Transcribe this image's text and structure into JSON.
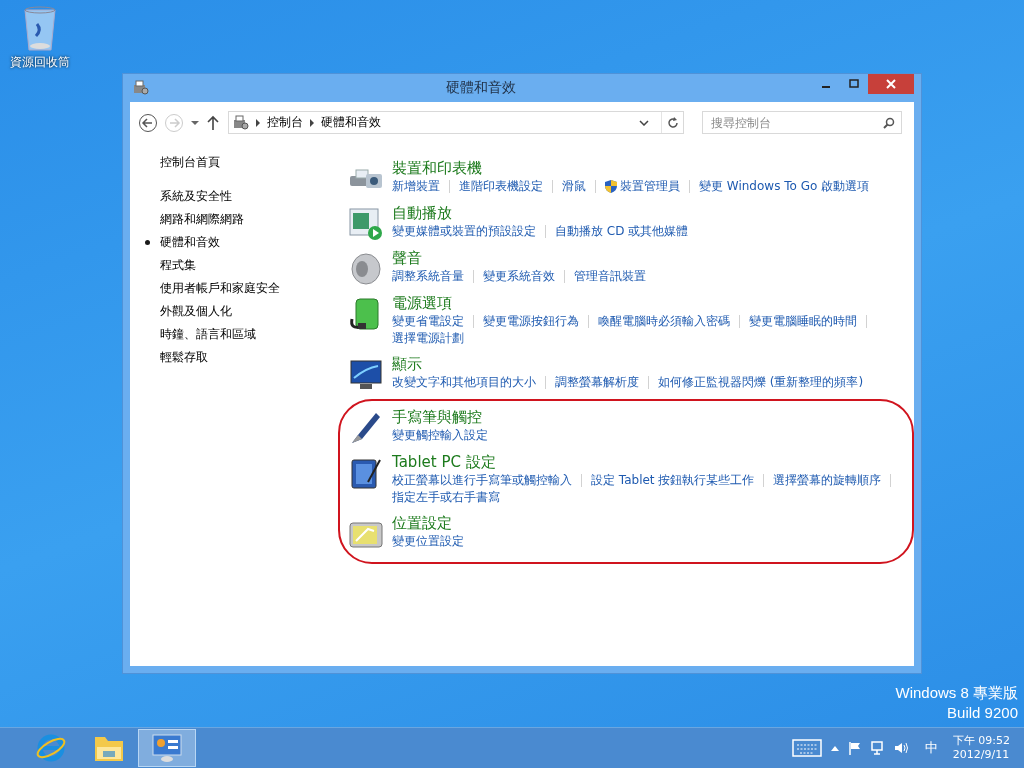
{
  "desktop_icons": [
    {
      "label": "資源回收筒"
    }
  ],
  "window": {
    "title": "硬體和音效"
  },
  "address_bar": {
    "breadcrumb": [
      "控制台",
      "硬體和音效"
    ]
  },
  "search": {
    "placeholder": "搜尋控制台"
  },
  "sidebar": {
    "home": "控制台首頁",
    "items": [
      {
        "label": "系統及安全性",
        "selected": false
      },
      {
        "label": "網路和網際網路",
        "selected": false
      },
      {
        "label": "硬體和音效",
        "selected": true
      },
      {
        "label": "程式集",
        "selected": false
      },
      {
        "label": "使用者帳戶和家庭安全",
        "selected": false
      },
      {
        "label": "外觀及個人化",
        "selected": false
      },
      {
        "label": "時鐘、語言和區域",
        "selected": false
      },
      {
        "label": "輕鬆存取",
        "selected": false
      }
    ]
  },
  "groups": [
    {
      "highlighted": false,
      "categories": [
        {
          "kind": "printer",
          "title": "裝置和印表機",
          "links": [
            {
              "text": "新增裝置",
              "shield": false
            },
            {
              "text": "進階印表機設定",
              "shield": false
            },
            {
              "text": "滑鼠",
              "shield": false
            },
            {
              "text": "裝置管理員",
              "shield": true
            },
            {
              "text": "變更 Windows To Go 啟動選項",
              "shield": false
            }
          ]
        },
        {
          "kind": "autoplay",
          "title": "自動播放",
          "links": [
            {
              "text": "變更媒體或裝置的預設設定",
              "shield": false
            },
            {
              "text": "自動播放 CD 或其他媒體",
              "shield": false
            }
          ]
        },
        {
          "kind": "speaker",
          "title": "聲音",
          "links": [
            {
              "text": "調整系統音量",
              "shield": false
            },
            {
              "text": "變更系統音效",
              "shield": false
            },
            {
              "text": "管理音訊裝置",
              "shield": false
            }
          ]
        },
        {
          "kind": "battery",
          "title": "電源選項",
          "links": [
            {
              "text": "變更省電設定",
              "shield": false
            },
            {
              "text": "變更電源按鈕行為",
              "shield": false
            },
            {
              "text": "喚醒電腦時必須輸入密碼",
              "shield": false
            },
            {
              "text": "變更電腦睡眠的時間",
              "shield": false
            },
            {
              "text": "選擇電源計劃",
              "shield": false
            }
          ]
        },
        {
          "kind": "monitor",
          "title": "顯示",
          "links": [
            {
              "text": "改變文字和其他項目的大小",
              "shield": false
            },
            {
              "text": "調整螢幕解析度",
              "shield": false
            },
            {
              "text": "如何修正監視器閃爍 (重新整理的頻率)",
              "shield": false
            }
          ]
        }
      ]
    },
    {
      "highlighted": true,
      "categories": [
        {
          "kind": "pen",
          "title": "手寫筆與觸控",
          "links": [
            {
              "text": "變更觸控輸入設定",
              "shield": false
            }
          ]
        },
        {
          "kind": "tablet",
          "title": "Tablet PC 設定",
          "links": [
            {
              "text": "校正螢幕以進行手寫筆或觸控輸入",
              "shield": false
            },
            {
              "text": "設定 Tablet 按鈕執行某些工作",
              "shield": false
            },
            {
              "text": "選擇螢幕的旋轉順序",
              "shield": false
            },
            {
              "text": "指定左手或右手書寫",
              "shield": false
            }
          ]
        },
        {
          "kind": "location",
          "title": "位置設定",
          "links": [
            {
              "text": "變更位置設定",
              "shield": false
            }
          ]
        }
      ]
    }
  ],
  "watermark": [
    "Windows 8 專業版",
    "Build 9200"
  ],
  "taskbar": {
    "apps": [
      {
        "kind": "browser",
        "selected": false
      },
      {
        "kind": "folder",
        "selected": false
      },
      {
        "kind": "control-panel",
        "selected": true
      }
    ],
    "ime": "中",
    "time": "下午 09:52",
    "date": "2012/9/11"
  }
}
